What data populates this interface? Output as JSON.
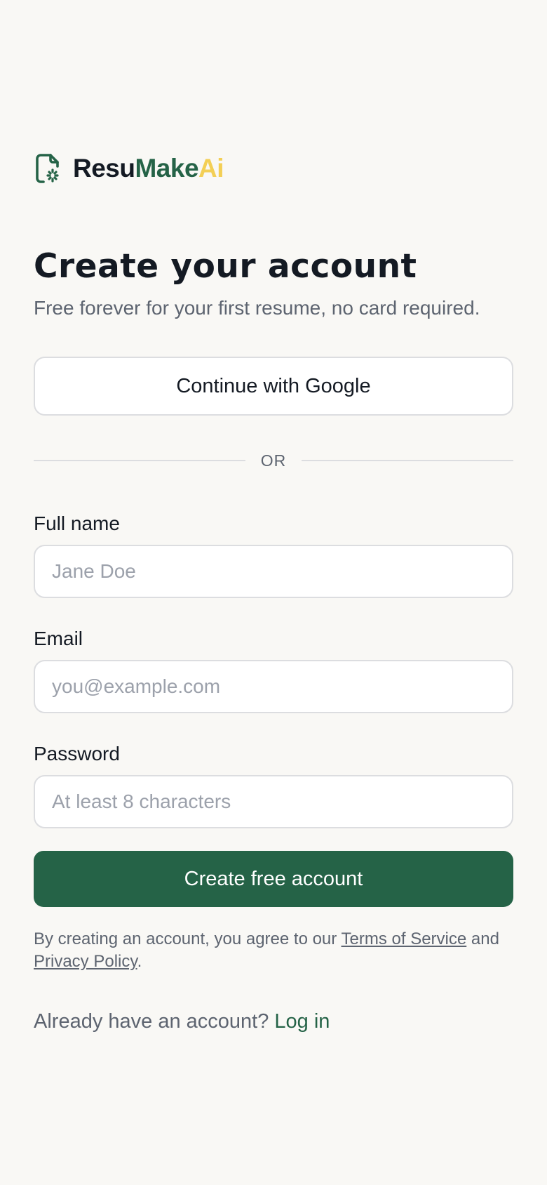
{
  "brand": {
    "name_part1": "Resu",
    "name_part2": "Make",
    "name_part3": "Ai",
    "colors": {
      "dark": "#141a23",
      "green": "#256347",
      "yellow": "#f3cf55"
    },
    "icon": "document-sparkle-icon"
  },
  "header": {
    "title": "Create your account",
    "subtitle": "Free forever for your first resume, no card required."
  },
  "oauth": {
    "google_label": "Continue with Google"
  },
  "divider": {
    "label": "OR"
  },
  "form": {
    "full_name": {
      "label": "Full name",
      "placeholder": "Jane Doe",
      "value": ""
    },
    "email": {
      "label": "Email",
      "placeholder": "you@example.com",
      "value": ""
    },
    "password": {
      "label": "Password",
      "placeholder": "At least 8 characters",
      "value": ""
    },
    "submit_label": "Create free account"
  },
  "legal": {
    "prefix": "By creating an account, you agree to our ",
    "terms_label": "Terms of Service",
    "middle": " and ",
    "privacy_label": "Privacy Policy",
    "suffix": "."
  },
  "footer": {
    "prompt": "Already have an account? ",
    "login_label": "Log in"
  }
}
